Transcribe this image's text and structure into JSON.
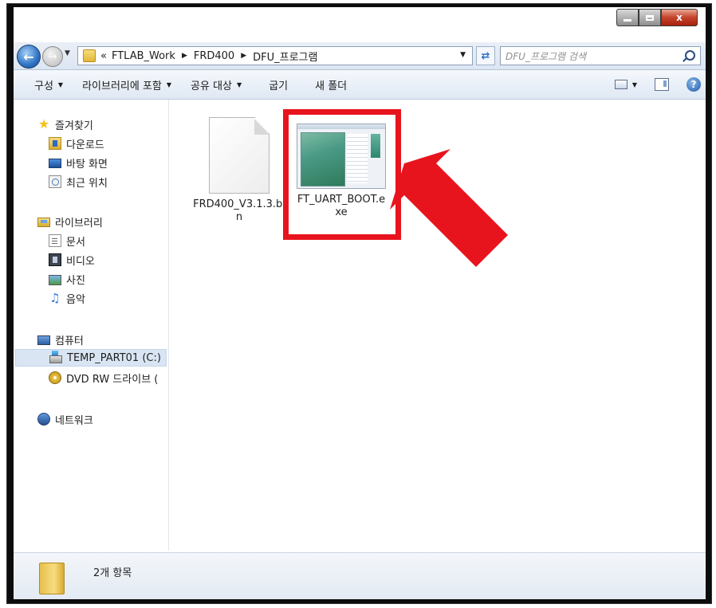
{
  "window": {
    "caption_buttons": {
      "minimize": "",
      "maximize": "",
      "close": "x"
    }
  },
  "address": {
    "overflow_symbol": "«",
    "breadcrumbs": [
      "FTLAB_Work",
      "FRD400",
      "DFU_프로그램"
    ],
    "search_placeholder": "DFU_프로그램 검색"
  },
  "toolbar": {
    "items": [
      {
        "label": "구성",
        "has_dropdown": true
      },
      {
        "label": "라이브러리에 포함",
        "has_dropdown": true
      },
      {
        "label": "공유 대상",
        "has_dropdown": true
      },
      {
        "label": "굽기",
        "has_dropdown": false
      },
      {
        "label": "새 폴더",
        "has_dropdown": false
      }
    ],
    "help_glyph": "?"
  },
  "nav": {
    "favorites": {
      "label": "즐겨찾기",
      "icon": "star-icon",
      "children": [
        {
          "label": "다운로드",
          "icon": "downloads-icon"
        },
        {
          "label": "바탕 화면",
          "icon": "desktop-icon"
        },
        {
          "label": "최근 위치",
          "icon": "recent-places-icon"
        }
      ]
    },
    "libraries": {
      "label": "라이브러리",
      "icon": "library-icon",
      "children": [
        {
          "label": "문서",
          "icon": "documents-icon"
        },
        {
          "label": "비디오",
          "icon": "video-icon"
        },
        {
          "label": "사진",
          "icon": "pictures-icon"
        },
        {
          "label": "음악",
          "icon": "music-icon"
        }
      ]
    },
    "computer": {
      "label": "컴퓨터",
      "icon": "computer-icon",
      "children": [
        {
          "label": "TEMP_PART01 (C:)",
          "icon": "drive-icon",
          "selected": true
        },
        {
          "label": "DVD RW 드라이브 (",
          "icon": "dvd-drive-icon"
        }
      ]
    },
    "network": {
      "label": "네트워크",
      "icon": "network-icon"
    }
  },
  "files": [
    {
      "name": "FRD400_V3.1.3.bin",
      "icon": "blank-file-icon",
      "highlighted": false
    },
    {
      "name": "FT_UART_BOOT.exe",
      "icon": "exe-window-icon",
      "highlighted": true
    }
  ],
  "annotation": {
    "highlight_color": "#e8141d",
    "arrow_color": "#e8141d"
  },
  "details": {
    "item_count_text": "2개 항목",
    "icon": "folder-icon"
  }
}
